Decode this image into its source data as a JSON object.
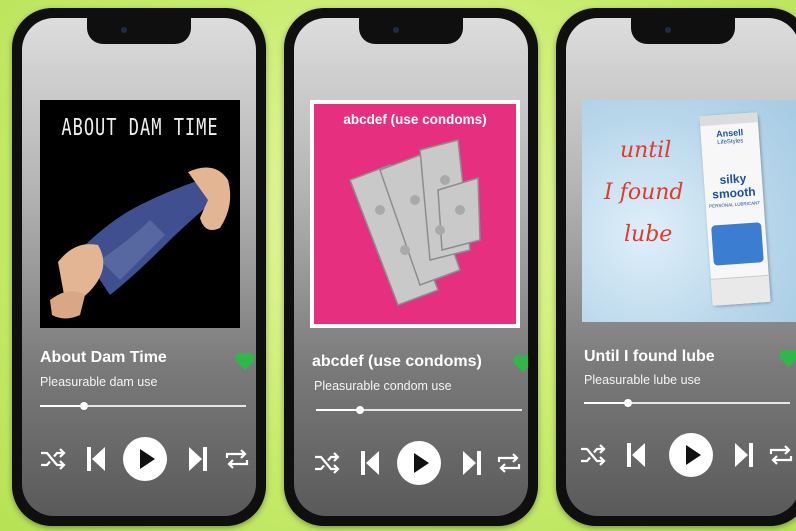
{
  "players": [
    {
      "album_text": "ABOUT DAM TIME",
      "title": "About Dam Time",
      "subtitle": "Pleasurable dam use",
      "liked": true,
      "progress": 0.2,
      "icons": [
        "shuffle-icon",
        "previous-icon",
        "play-icon",
        "next-icon",
        "repeat-icon",
        "heart-icon"
      ]
    },
    {
      "album_text": "abcdef (use condoms)",
      "title": "abcdef (use condoms)",
      "subtitle": "Pleasurable condom use",
      "liked": true,
      "progress": 0.2,
      "icons": [
        "shuffle-icon",
        "previous-icon",
        "play-icon",
        "next-icon",
        "repeat-icon",
        "heart-icon"
      ]
    },
    {
      "album_text_lines": [
        "until",
        "I found",
        "lube"
      ],
      "tube_brand": "Ansell",
      "tube_sub": "LifeStyles",
      "tube_label_1": "silky",
      "tube_label_2": "smooth",
      "tube_small": "PERSONAL LUBRICANT",
      "title": "Until I found lube",
      "subtitle": "Pleasurable lube use",
      "liked": true,
      "progress": 0.2,
      "icons": [
        "shuffle-icon",
        "previous-icon",
        "play-icon",
        "next-icon",
        "repeat-icon",
        "heart-icon"
      ]
    }
  ],
  "colors": {
    "background": "#c8ec6e",
    "heart": "#2fb84a",
    "album2_pink": "#e6307f",
    "lube_text": "#e03a2b"
  }
}
